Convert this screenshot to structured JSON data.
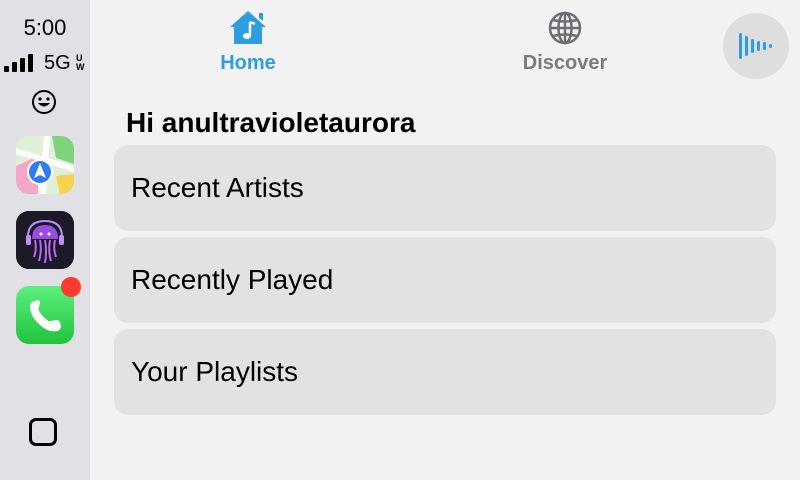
{
  "status_bar": {
    "time": "5:00",
    "network": "5G",
    "network_suffix": "UW",
    "signal_bars": 4
  },
  "sidebar": {
    "apps": [
      {
        "name": "maps",
        "icon": "maps-app-icon"
      },
      {
        "name": "music",
        "icon": "jellyfish-music-app-icon"
      },
      {
        "name": "phone",
        "icon": "phone-app-icon",
        "has_notification_badge": true
      }
    ],
    "emoji_icon": "smiley-icon",
    "home_icon": "dashboard-square-icon"
  },
  "nav": {
    "tabs": [
      {
        "label": "Home",
        "icon": "home-music-icon",
        "active": true
      },
      {
        "label": "Discover",
        "icon": "globe-icon",
        "active": false
      }
    ],
    "voice_icon": "waveform-icon"
  },
  "main": {
    "greeting": "Hi anultravioletaurora",
    "items": [
      {
        "label": "Recent Artists"
      },
      {
        "label": "Recently Played"
      },
      {
        "label": "Your Playlists"
      }
    ]
  },
  "colors": {
    "accent": "#2f9ee0",
    "inactive": "#7a7a7f",
    "badge": "#ff3b30",
    "sidebar_bg": "#e0e0e5",
    "card_bg": "#e2e2e2"
  }
}
